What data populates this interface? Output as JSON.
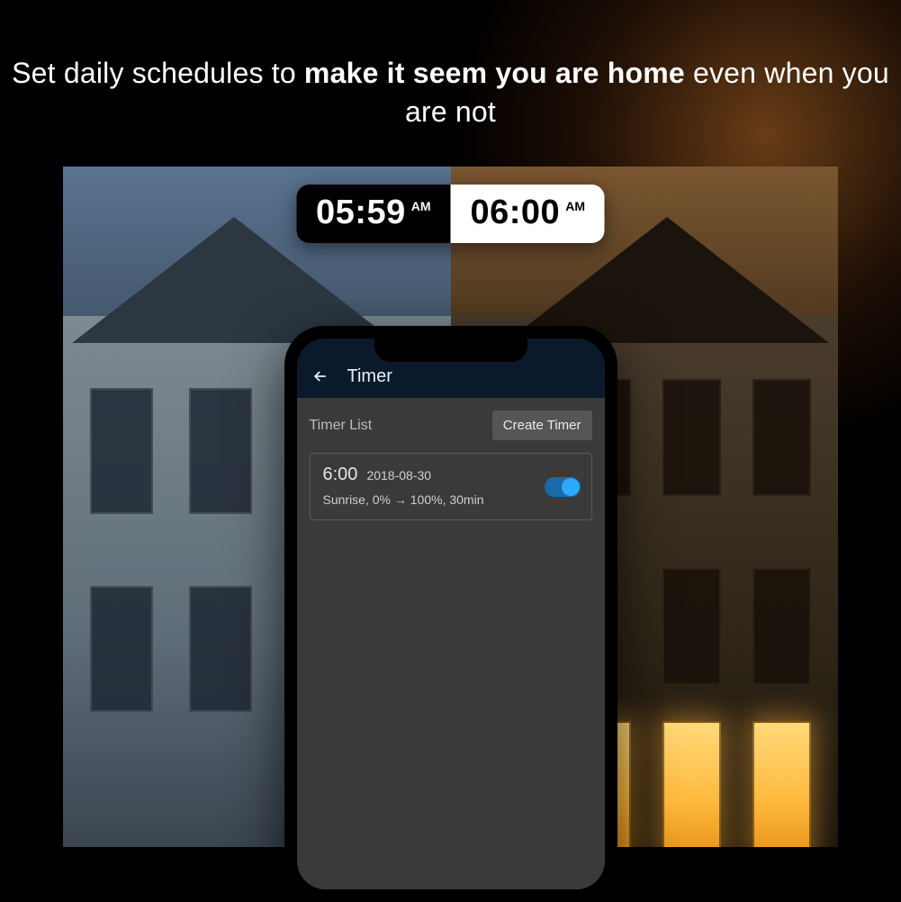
{
  "tagline": {
    "part1": "Set daily schedules to ",
    "bold": "make it seem you are home",
    "part2": " even when you are not"
  },
  "timepill": {
    "left_time": "05:59",
    "left_ampm": "AM",
    "right_time": "06:00",
    "right_ampm": "AM"
  },
  "phone": {
    "topbar_title": "Timer",
    "list_label": "Timer List",
    "create_button": "Create Timer",
    "timer": {
      "time": "6:00",
      "date": "2018-08-30",
      "detail": "Sunrise, 0% → 100%, 30min",
      "enabled": true
    }
  }
}
